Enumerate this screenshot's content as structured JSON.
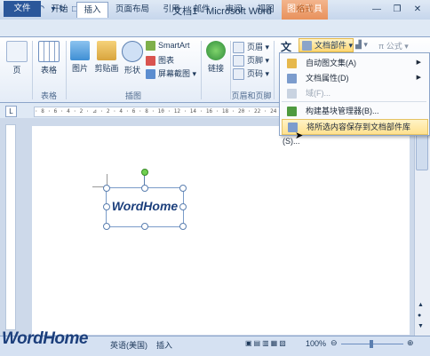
{
  "titlebar": {
    "title": "文档1 - Microsoft Word",
    "context_tab": "图片工具",
    "app_icon": "W"
  },
  "tabs": [
    {
      "label": "文件"
    },
    {
      "label": "开始"
    },
    {
      "label": "插入"
    },
    {
      "label": "页面布局"
    },
    {
      "label": "引用"
    },
    {
      "label": "邮件"
    },
    {
      "label": "审阅"
    },
    {
      "label": "视图"
    },
    {
      "label": "格式"
    }
  ],
  "ribbon": {
    "page": "页",
    "table": "表格",
    "picture": "图片",
    "clipart": "剪贴画",
    "shapes": "形状",
    "smartart": "SmartArt",
    "chart": "图表",
    "screenshot": "屏幕截图",
    "link": "链接",
    "header": "页眉",
    "footer": "页脚",
    "pagenum": "页码",
    "textbox": "文",
    "quickparts": "文档部件",
    "formula": "公式",
    "group_table": "表格",
    "group_illus": "插图",
    "group_hf": "页眉和页脚"
  },
  "menu": {
    "items": [
      {
        "label": "自动图文集(A)"
      },
      {
        "label": "文档属性(D)"
      },
      {
        "label": "域(F)..."
      },
      {
        "label": "构建基块管理器(B)..."
      },
      {
        "label": "将所选内容保存到文档部件库(S)..."
      }
    ]
  },
  "document": {
    "logo": "WordHome"
  },
  "ruler": {
    "marks": "· 8 · 6 · 4 · 2 · ⊿ · 2 · 4 · 6 · 8 · 10 · 12 · 14 · 16 · 18 · 20 · 22 · 24 · 26 · 28 · 30 · 32 · 34 · 36 · 38"
  },
  "status": {
    "language": "英语(美国)",
    "mode": "插入",
    "zoom": "100%"
  },
  "watermark": "WordHome",
  "colors": {
    "accent": "#2b579a",
    "context": "#e8915c",
    "highlight": "#ffe18f"
  }
}
